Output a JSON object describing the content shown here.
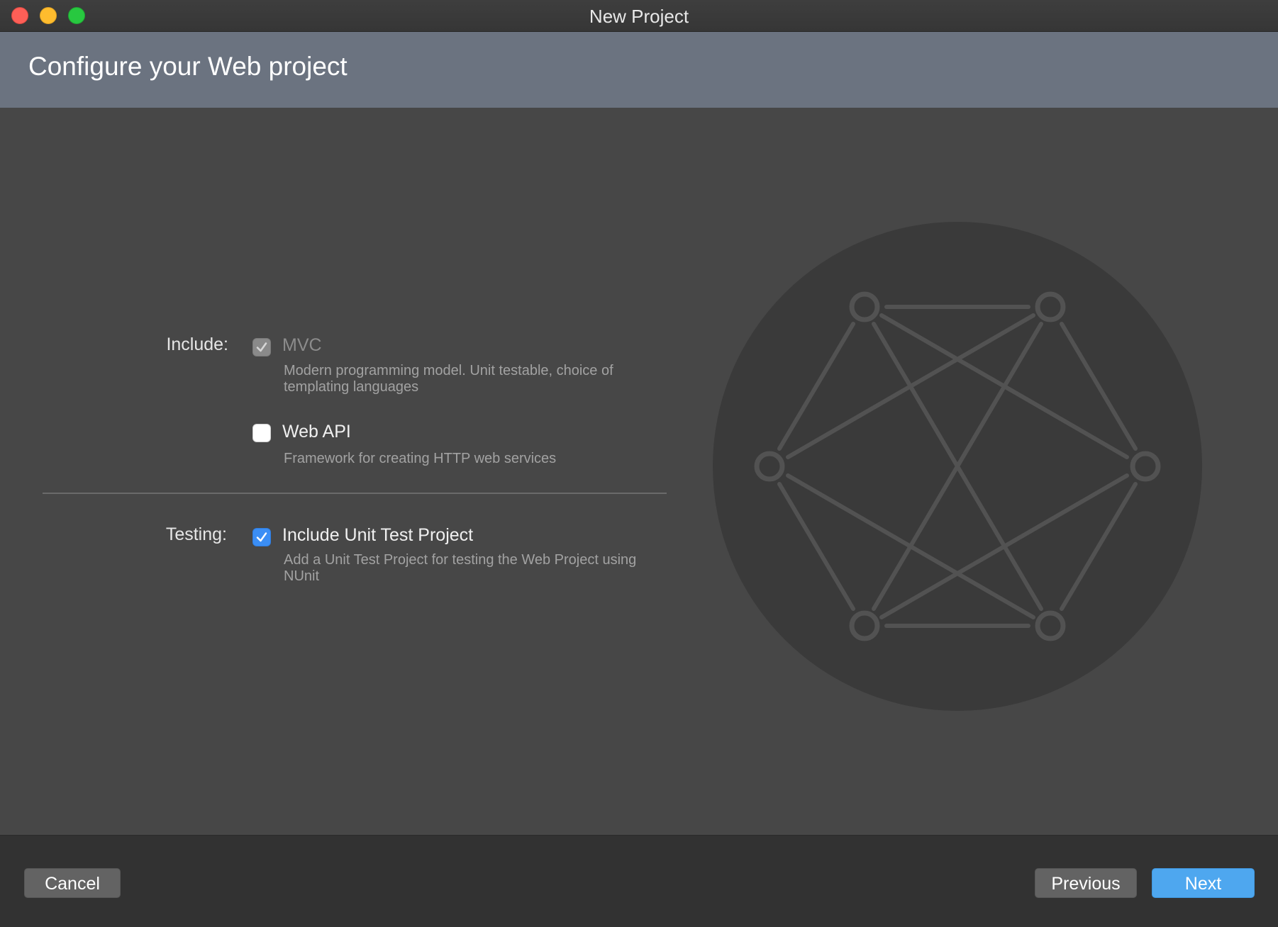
{
  "window": {
    "title": "New Project"
  },
  "header": {
    "title": "Configure your Web project"
  },
  "include": {
    "label": "Include:",
    "options": [
      {
        "label": "MVC",
        "description": "Modern programming model. Unit testable, choice of templating languages",
        "checked": true,
        "enabled": false
      },
      {
        "label": "Web API",
        "description": "Framework for creating HTTP web services",
        "checked": false,
        "enabled": true
      }
    ]
  },
  "testing": {
    "label": "Testing:",
    "options": [
      {
        "label": "Include Unit Test Project",
        "description": "Add a Unit Test Project for testing the Web Project using NUnit",
        "checked": true,
        "enabled": true
      }
    ]
  },
  "footer": {
    "cancel_label": "Cancel",
    "previous_label": "Previous",
    "next_label": "Next"
  },
  "colors": {
    "accent": "#4ea7ef",
    "checkbox_checked": "#3b8ef5",
    "header_bg": "#6b7380",
    "content_bg": "#474747",
    "footer_bg": "#323232"
  },
  "icons": {
    "illustration": "network-graph-icon"
  }
}
